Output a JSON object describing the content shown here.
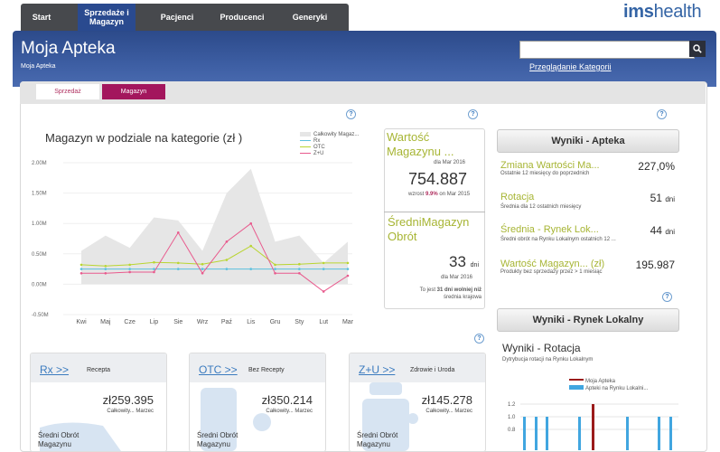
{
  "nav": {
    "tabs": [
      {
        "label": "Start"
      },
      {
        "label": "Sprzedaże i Magazyn"
      },
      {
        "label": "Pacjenci"
      },
      {
        "label": "Producenci"
      },
      {
        "label": "Generyki"
      }
    ]
  },
  "logo": {
    "part1": "ims",
    "part2": "health"
  },
  "header": {
    "title": "Moja Apteka",
    "breadcrumb": "Moja Apteka",
    "search_placeholder": "",
    "category_link": "Przeglądanie Kategorii"
  },
  "subtabs": [
    {
      "label": "Sprzedaż",
      "active": false
    },
    {
      "label": "Magazyn",
      "active": true
    }
  ],
  "help_glyph": "?",
  "chart": {
    "title": "Magazyn w podziale na kategorie (zł )",
    "legend": [
      "Całkowity Magaz...",
      "Rx",
      "OTC",
      "Z+U"
    ],
    "chart_data": {
      "type": "line",
      "title": "Magazyn w podziale na kategorie (zł )",
      "categories": [
        "Kwi",
        "Maj",
        "Cze",
        "Lip",
        "Sie",
        "Wrz",
        "Paź",
        "Lis",
        "Gru",
        "Sty",
        "Lut",
        "Mar"
      ],
      "y_ticks": [
        "-0.50M",
        "0.00M",
        "0.50M",
        "1.00M",
        "1.50M",
        "2.00M"
      ],
      "ylim": [
        -0.5,
        2.0
      ],
      "series": [
        {
          "name": "Całkowity Magaz...",
          "color": "#e6e6e6",
          "values": [
            0.55,
            0.8,
            0.6,
            1.1,
            1.05,
            0.55,
            1.5,
            1.9,
            0.7,
            0.8,
            0.35,
            0.7
          ]
        },
        {
          "name": "Rx",
          "color": "#5bc0de",
          "values": [
            0.25,
            0.25,
            0.25,
            0.25,
            0.25,
            0.25,
            0.25,
            0.25,
            0.25,
            0.25,
            0.25,
            0.25
          ]
        },
        {
          "name": "OTC",
          "color": "#b9d531",
          "values": [
            0.32,
            0.3,
            0.32,
            0.36,
            0.35,
            0.33,
            0.4,
            0.63,
            0.32,
            0.33,
            0.35,
            0.35
          ]
        },
        {
          "name": "Z+U",
          "color": "#e85a8d",
          "values": [
            0.18,
            0.18,
            0.2,
            0.2,
            0.85,
            0.18,
            0.7,
            1.0,
            0.18,
            0.18,
            -0.12,
            0.14
          ]
        }
      ]
    }
  },
  "value_card": {
    "title": "Wartość Magazynu ...",
    "date1": "dla Mar 2016",
    "value": "754.887",
    "growth_prefix": "wzrost",
    "growth": "9.9%",
    "growth_suffix": "on  Mar 2015",
    "avg_title": "ŚredniMagazyn Obrót",
    "days": "33",
    "days_unit": "dni",
    "date2": "dla Mar 2016",
    "note_prefix": "To jest",
    "note_bold": "31 dni wolniej niż",
    "note_suffix": "średnia krajowa"
  },
  "results_pharmacy": {
    "header": "Wyniki - Apteka",
    "items": [
      {
        "label": "Zmiana Wartości Ma...",
        "sub": "Ostatnie 12 miesięcy do poprzednich",
        "value": "227,0%",
        "unit": ""
      },
      {
        "label": "Rotacja",
        "sub": "Średnia dla 12 ostatnich miesięcy",
        "value": "51",
        "unit": "dni"
      },
      {
        "label": "Średnia - Rynek Lok...",
        "sub": "Średni obrót na Rynku Lokalnym ostatnich 12 ...",
        "value": "44",
        "unit": "dni"
      },
      {
        "label": "Wartość Magazyn... (zł)",
        "sub": "Produkty bez sprzedaży przez > 1 miesiąc",
        "value": "195.987",
        "unit": ""
      }
    ]
  },
  "results_market": {
    "header": "Wyniki - Rynek Lokalny",
    "rotation_title": "Wyniki - Rotacja",
    "rotation_sub": "Dytrybucja rotacji na Rynku Lokalnym",
    "legend": [
      "Moja Apteka",
      "Apteki na Rynku Lokalni..."
    ],
    "chart_data": {
      "type": "bar",
      "y_ticks": [
        "0.8",
        "1.0",
        "1.2"
      ],
      "series": [
        {
          "name": "Moja Apteka",
          "color": "#9b1b1b"
        },
        {
          "name": "Apteki na Rynku Lokalni...",
          "color": "#41a6e0"
        }
      ]
    }
  },
  "cards": [
    {
      "link": "Rx >>",
      "desc": "Recepta",
      "value": "zł259.395",
      "sub": "Całkowity... Marzec",
      "foot1": "Średni Obrót",
      "foot2": "Magazynu"
    },
    {
      "link": "OTC >>",
      "desc": "Bez Recepty",
      "value": "zł350.214",
      "sub": "Całkowity... Marzec",
      "foot1": "Średni Obrót",
      "foot2": "Magazynu"
    },
    {
      "link": "Z+U >>",
      "desc": "Zdrowie i Uroda",
      "value": "zł145.278",
      "sub": "Całkowity... Marzec",
      "foot1": "Średni Obrót",
      "foot2": "Magazynu"
    }
  ]
}
